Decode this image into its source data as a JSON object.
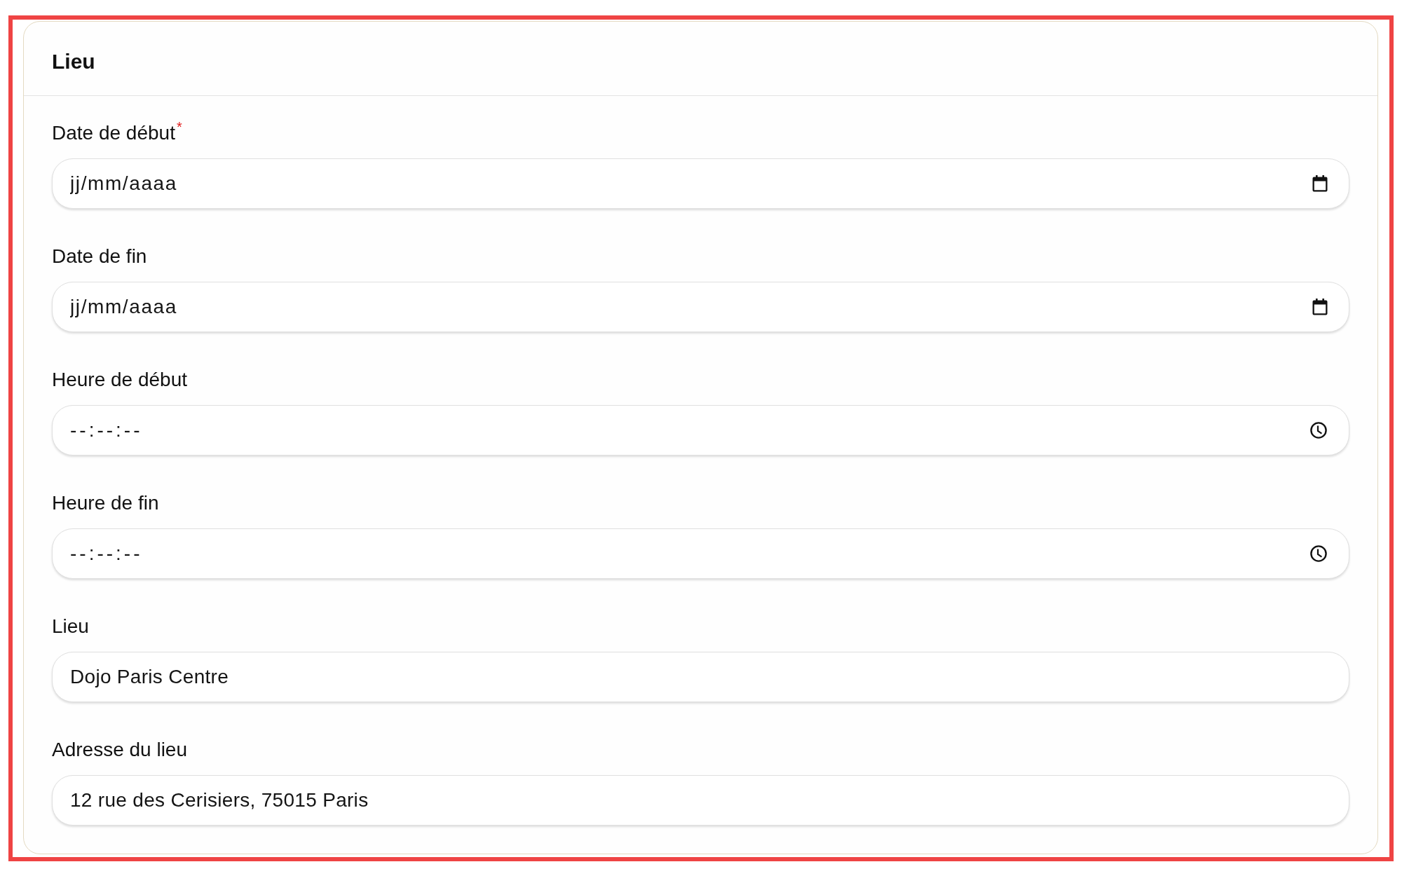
{
  "section": {
    "title": "Lieu"
  },
  "fields": [
    {
      "label": "Date de début",
      "required_mark": "*",
      "kind": "date",
      "placeholder": "jj/mm/aaaa"
    },
    {
      "label": "Date de fin",
      "kind": "date",
      "placeholder": "jj/mm/aaaa"
    },
    {
      "label": "Heure de début",
      "kind": "time",
      "placeholder": "--:--:--"
    },
    {
      "label": "Heure de fin",
      "kind": "time",
      "placeholder": "--:--:--"
    },
    {
      "label": "Lieu",
      "kind": "text",
      "value": "Dojo Paris Centre"
    },
    {
      "label": "Adresse du lieu",
      "kind": "text",
      "value": "12 rue des Cerisiers, 75015 Paris"
    }
  ]
}
